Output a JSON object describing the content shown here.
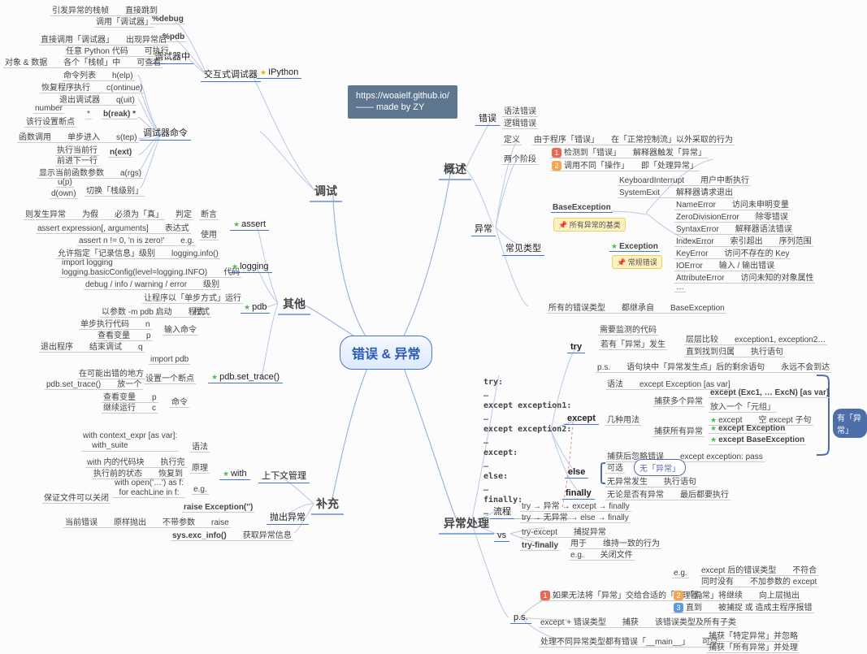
{
  "watermark": {
    "line1": "https://woaielf.github.io/",
    "line2": "—— made by ZY"
  },
  "root": "错误 & 异常",
  "branch_debug": "调试",
  "branch_other": "其他",
  "branch_supp": "补充",
  "branch_overview": "概述",
  "branch_exhandle": "异常处理",
  "l_debug_pct": "%debug",
  "l_debug_dir": "引发异常的栈帧　　直接跳到",
  "l_debug_call": "调用「调试器」",
  "l_pdb_pct": "%pdb",
  "l_pdb_dir": "直接调用「调试器」　　出现异常后",
  "l_dbg_mid": "调试器中",
  "l_dbg_mid_a": "任意 Python 代码　　可执行",
  "l_dbg_mid_b": "对象 & 数据　　各个「栈帧」中　　可查看",
  "l_inter": "交互式调试器",
  "l_ipython": "IPython",
  "l_cmds": "调试器命令",
  "l_help": "命令列表　　h(elp)",
  "l_cont": "恢复程序执行　　c(ontinue)",
  "l_quit": "退出调试器　　q(uit)",
  "l_break": "b(reak) *",
  "l_break_a": "number",
  "l_break_b": "该行设置断点",
  "l_step": "函数调用　　单步进入　　s(tep)",
  "l_next": "n(ext)",
  "l_next_a": "执行当前行",
  "l_next_b": "前进下一行",
  "l_args": "显示当前函数参数　　a(rgs)",
  "l_updown_a": "u(p)",
  "l_updown_b": "d(own)",
  "l_updown_c": "切换「栈级别」",
  "l_assert": "assert",
  "l_assert_a": "断言",
  "l_assert_b": "判定",
  "l_assert_c": "则发生异常　　为假　　必须为「真」",
  "l_assert_use": "使用",
  "l_assert_expr": "assert expression[, arguments]　　表达式",
  "l_assert_eg": "assert n != 0, 'n is zero!'　　e.g.",
  "l_logging": "logging",
  "l_log_a": "允许指定「记录信息」级别　　logging.info()",
  "l_log_b": "import logging\\nlogging.basicConfig(level=logging.INFO)　　代码",
  "l_log_c": "debug / info / warning / error　　级别",
  "l_pdb": "pdb",
  "l_pdb_a": "让程序以「单步方式」运行",
  "l_pdb_b": "以参数 -m pdb 启动　　程式",
  "l_pdb_c": "输入命令",
  "l_pdb_c1": "单步执行代码　　n",
  "l_pdb_c2": "查看变量　　p",
  "l_pdb_c3": "退出程序　　结束调试　　q",
  "l_pst": "pdb.set_trace()",
  "l_pst_a": "import pdb",
  "l_pst_b": "设置一个断点",
  "l_pst_b1": "在可能出错的地方",
  "l_pst_b2": "pdb.set_trace()　　放一个",
  "l_pst_c": "命令",
  "l_pst_c1": "查看变量　　p",
  "l_pst_c2": "继续运行　　c",
  "l_ctx": "上下文管理",
  "l_with": "with",
  "l_with_a": "with context_expr [as var]:\\n    with_suite",
  "l_with_a_lbl": "语法",
  "l_with_b_head": "原理",
  "l_with_b1": "with 内的代码块　　执行完",
  "l_with_b2": "执行前的状态　　恢复到",
  "l_with_c": "e.g.",
  "l_with_c1": "with open('…') as f:\\n    for eachLine in f:",
  "l_with_c2": "保证文件可以关闭",
  "l_throw": "抛出异常",
  "l_throw_r1": "raise Exception('')",
  "l_throw_r2": "当前错误　　原样抛出　　不带参数　　raise",
  "l_throw_s": "sys.exc_info()　　获取异常信息",
  "r_err": "错误",
  "r_err_a": "语法错误",
  "r_err_b": "逻辑错误",
  "r_ex": "异常",
  "r_ex_def": "定义",
  "r_ex_def_t": "由于程序「错误」　　在「正常控制流」以外采取的行为",
  "r_ex_phase": "两个阶段",
  "r_ex_p1": "检测到「错误」　　解释器触发「异常」",
  "r_ex_p2": "调用不同「操作」　　即「处理异常」",
  "r_ex_types": "常见类型",
  "r_tag1": "所有异常的基类",
  "r_base": "BaseException",
  "r_exc": "Exception",
  "r_tag2": "常规错误",
  "r_t1": "KeyboardInterrupt　　用户中断执行",
  "r_t2": "SystemExit　　解释器请求退出",
  "r_t3": "NameError　　访问未申明变量",
  "r_t4": "ZeroDivisionError　　除零错误",
  "r_t5": "SyntaxError　　解释器语法错误",
  "r_t6": "IndexError　　索引超出　　序列范围",
  "r_t7": "KeyError　　访问不存在的 Key",
  "r_t8": "IOError　　输入 / 输出错误",
  "r_t9": "AttributeError　　访问未知的对象属性",
  "r_t10": "…",
  "r_inherit": "所有的错误类型　　都继承自　　BaseException",
  "eh_try": "try",
  "eh_try_a": "需要监测的代码",
  "eh_try_b": "若有「异常」发生",
  "eh_try_b1": "层层比较　　exception1, exception2…",
  "eh_try_b2": "直到找到归属　　执行语句",
  "eh_try_c": "p.s.　　语句块中「异常发生点」后的剩余语句　　永远不会到达",
  "eh_except": "except",
  "eh_ex_syntax": "语法　　except Exception [as var]",
  "eh_ex_multi": "捕获多个异常",
  "eh_ex_multi1": "except (Exc1, … ExcN) [as var]",
  "eh_ex_multi2": "放入一个「元组」",
  "eh_ex_use": "几种用法",
  "eh_ex_all": "捕获所有异常",
  "eh_ex_a1": "except　　空 except 子句",
  "eh_ex_a2": "except Exception",
  "eh_ex_a3": "except BaseException",
  "eh_ex_suppress": "捕获后忽略错误　　except exception: pass",
  "eh_else": "else",
  "eh_else_a": "可选",
  "eh_else_lbl": "无「异常」",
  "eh_else_b": "无异常发生　　执行语句",
  "eh_finally": "finally",
  "eh_finally_a": "无论是否有异常　　最后都要执行",
  "eh_code_try": "try:",
  "eh_code_e1": "except exception1:",
  "eh_code_e2": "except exception2:",
  "eh_code_ex": "except:",
  "eh_code_el": "else:",
  "eh_code_fn": "finally:",
  "eh_code_d": "…",
  "eh_flow": "流程",
  "eh_flow1": "try → 异常 → except → finally",
  "eh_flow2": "try → 无异常 → else → finally",
  "eh_vs": "vs",
  "eh_vs_te": "try-except　　捕捉异常",
  "eh_vs_tf": "try-finally",
  "eh_vs_tf1": "用于　　维持一致的行为",
  "eh_vs_tf2": "e.g.　　关闭文件",
  "eh_ps": "p.s.",
  "eh_ps1": "如果无法将「异常」交给合适的「处理器」",
  "eh_ps1a": "e.g.",
  "eh_ps1a1": "except 后的错误类型　　不符合",
  "eh_ps1a2": "同时没有　　不加参数的 except",
  "eh_ps1b": "「异常」将继续　　向上层抛出",
  "eh_ps1c": "直到　　被捕捉 或 造成主程序报错",
  "eh_ps2": "except + 错误类型　　捕获　　该错误类型及所有子类",
  "eh_ps3": "处理不同异常类型都有错误「__main__」　　可以",
  "eh_ps3a": "捕获「特定异常」并忽略",
  "eh_ps3b": "捕获「所有异常」并处理",
  "bracket_have": "有「异常」"
}
